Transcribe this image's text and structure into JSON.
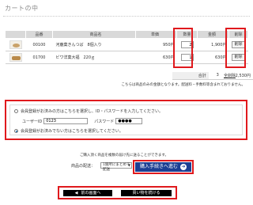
{
  "page_title": "カートの中",
  "table": {
    "headers": [
      "品番",
      "商品名",
      "単価",
      "数量",
      "金額",
      "削除"
    ],
    "rows": [
      {
        "code": "00100",
        "name": "河鹿菓きんつば　8個入り",
        "price": "950円",
        "qty": "2",
        "amount": "1,900円",
        "delete": "削除",
        "image": "kintsuba-thumbnail"
      },
      {
        "code": "01700",
        "name": "ビワ洋菓大福　220ｇ",
        "price": "630円",
        "qty": "1",
        "amount": "630円",
        "delete": "削除",
        "image": "daifuku-thumbnail"
      }
    ]
  },
  "summary": {
    "label": "合計",
    "qty": "3",
    "amount": "2,530円",
    "clear_link": "全削除"
  },
  "note_prices": "こちらは商品のみの金額となります。配送料・手数料等含まれておりません。",
  "member": {
    "option_member": "会員登録がお済みの方はこちらを選択し、ID・パスワードを入力してください。",
    "userid_label": "ユーザーID",
    "userid_value": "0123",
    "password_label": "パスワード",
    "password_value": "●●●●",
    "option_guest": "会員登録がお済みでない方はこちらを選択してください。"
  },
  "shipping": {
    "note": "ご購入頂く商品を複数の届け先に送ることができます。",
    "label": "商品の配送：",
    "select_value": "1箇所にまとめて配送"
  },
  "buttons": {
    "proceed": "購入手続きへ進む",
    "back": "前の画面へ",
    "continue": "買い物を続ける"
  },
  "colors": {
    "accent_red": "#e0191d",
    "primary_blue": "#1c3f93"
  }
}
